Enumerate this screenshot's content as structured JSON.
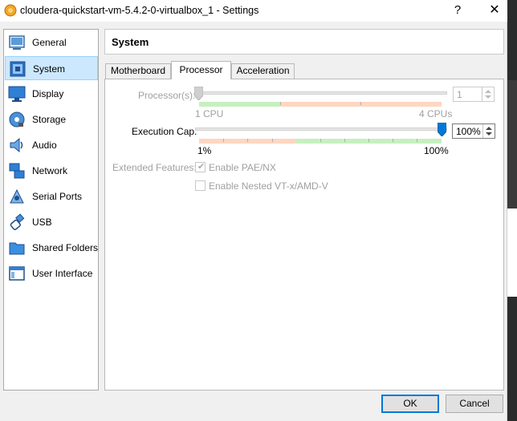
{
  "window": {
    "title": "cloudera-quickstart-vm-5.4.2-0-virtualbox_1 - Settings",
    "help_label": "?",
    "close_label": "✕"
  },
  "sidebar": {
    "items": [
      {
        "label": "General",
        "icon": "general-icon"
      },
      {
        "label": "System",
        "icon": "system-icon",
        "selected": true
      },
      {
        "label": "Display",
        "icon": "display-icon"
      },
      {
        "label": "Storage",
        "icon": "storage-icon"
      },
      {
        "label": "Audio",
        "icon": "audio-icon"
      },
      {
        "label": "Network",
        "icon": "network-icon"
      },
      {
        "label": "Serial Ports",
        "icon": "serial-ports-icon"
      },
      {
        "label": "USB",
        "icon": "usb-icon"
      },
      {
        "label": "Shared Folders",
        "icon": "shared-folders-icon"
      },
      {
        "label": "User Interface",
        "icon": "user-interface-icon"
      }
    ]
  },
  "section": {
    "title": "System"
  },
  "tabs": [
    {
      "label": "Motherboard",
      "active": false
    },
    {
      "label": "Processor",
      "active": true
    },
    {
      "label": "Acceleration",
      "active": false
    }
  ],
  "processor": {
    "processors_label": "Processor(s):",
    "processors_value": "1",
    "processors_min_label": "1 CPU",
    "processors_max_label": "4 CPUs",
    "processors_enabled": false,
    "exec_cap_label": "Execution Cap:",
    "exec_cap_value": "100%",
    "exec_cap_fraction": 1.0,
    "exec_cap_min_label": "1%",
    "exec_cap_max_label": "100%",
    "extended_features_label": "Extended Features:",
    "pae_label": "Enable PAE/NX",
    "pae_checked": true,
    "nested_label": "Enable Nested VT-x/AMD-V",
    "nested_checked": false
  },
  "footer": {
    "ok_label": "OK",
    "cancel_label": "Cancel"
  },
  "colors": {
    "accent": "#0078d7",
    "selection": "#cce8ff",
    "scale_good": "#c6f0c0",
    "scale_warn": "#ffd6c2"
  }
}
